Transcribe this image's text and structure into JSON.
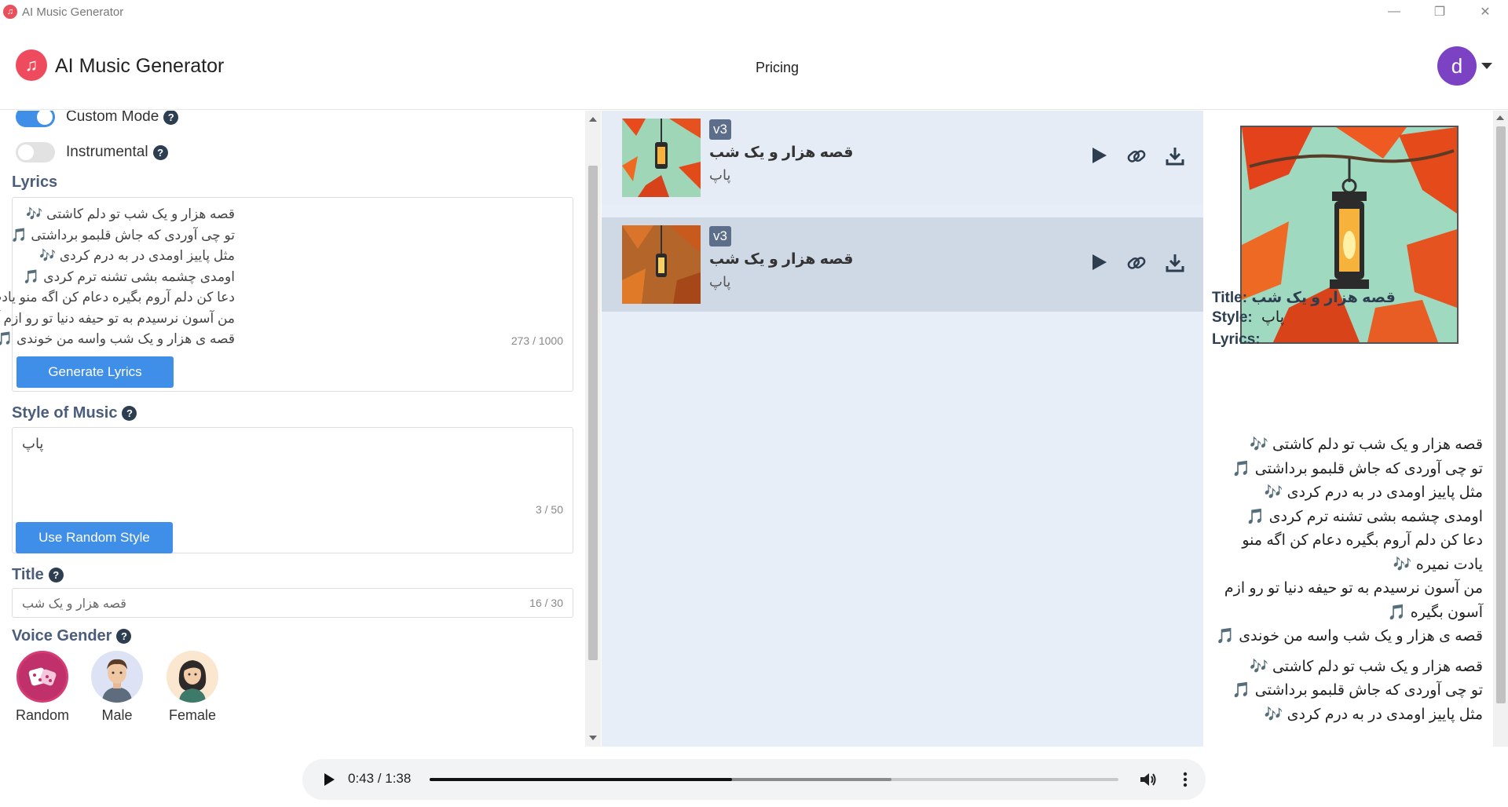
{
  "window": {
    "title": "AI Music Generator",
    "controls": [
      "—",
      "❐",
      "✕"
    ]
  },
  "header": {
    "brand": "AI Music Generator",
    "nav_pricing": "Pricing",
    "avatar_letter": "d"
  },
  "form": {
    "custom_mode_label": "Custom Mode",
    "custom_mode_on": true,
    "instrumental_label": "Instrumental",
    "instrumental_on": false,
    "help_glyph": "?",
    "lyrics_label": "Lyrics",
    "lyrics_lines": [
      "قصه هزار و یک شب تو دلم کاشتی 🎶",
      "تو چی آوردی که جاش قلبمو برداشتی 🎵",
      "مثل پاییز اومدی در به درم کردی 🎶",
      "اومدی چشمه بشی تشنه ترم کردی 🎵",
      "دعا کن دلم آروم بگیره دعام کن اگه منو یادت نمیره 🎶",
      "من آسون نرسیدم به تو حیفه دنیا تو رو ازم آسون بگیره 🎵",
      "قصه ی هزار و یک شب واسه من خوندی 🎵"
    ],
    "lyrics_counter": "273 / 1000",
    "generate_lyrics_button": "Generate Lyrics",
    "style_label": "Style of Music",
    "style_value": "پاپ",
    "style_counter": "3 / 50",
    "random_style_button": "Use Random Style",
    "title_label": "Title",
    "title_value": "قصه هزار و یک شب",
    "title_counter": "16 / 30",
    "voice_label": "Voice Gender",
    "voices": [
      "Random",
      "Male",
      "Female"
    ]
  },
  "songs": [
    {
      "version": "v3",
      "title": "قصه هزار و یک شب",
      "style": "پاپ"
    },
    {
      "version": "v3",
      "title": "قصه هزار و یک شب",
      "style": "پاپ"
    }
  ],
  "detail": {
    "title_label": "Title:",
    "title_value": "قصه هزار و یک شب",
    "style_label": "Style:",
    "style_value": "پاپ",
    "lyrics_label": "Lyrics:",
    "lyrics_lines": [
      "قصه هزار و یک شب تو دلم کاشتی 🎶",
      "تو چی آوردی که جاش قلبمو برداشتی 🎵",
      "مثل پاییز اومدی در به درم کردی 🎶",
      "اومدی چشمه بشی تشنه ترم کردی 🎵",
      "دعا کن دلم آروم بگیره دعام کن اگه منو یادت نمیره 🎶",
      "من آسون نرسیدم به تو حیفه دنیا تو رو ازم آسون بگیره 🎵",
      "قصه ی هزار و یک شب واسه من خوندی 🎵",
      "",
      "قصه هزار و یک شب تو دلم کاشتی 🎶",
      "تو چی آوردی که جاش قلبمو برداشتی 🎵",
      "مثل پاییز اومدی در به درم کردی 🎶"
    ]
  },
  "player": {
    "time": "0:43 / 1:38",
    "played_fraction": 0.4388,
    "buffered_fraction": 0.67
  },
  "colors": {
    "accent": "#3f8ee8",
    "brand": "#ef4b5e",
    "avatar": "#7b43c4",
    "label": "#4a5d7a"
  }
}
